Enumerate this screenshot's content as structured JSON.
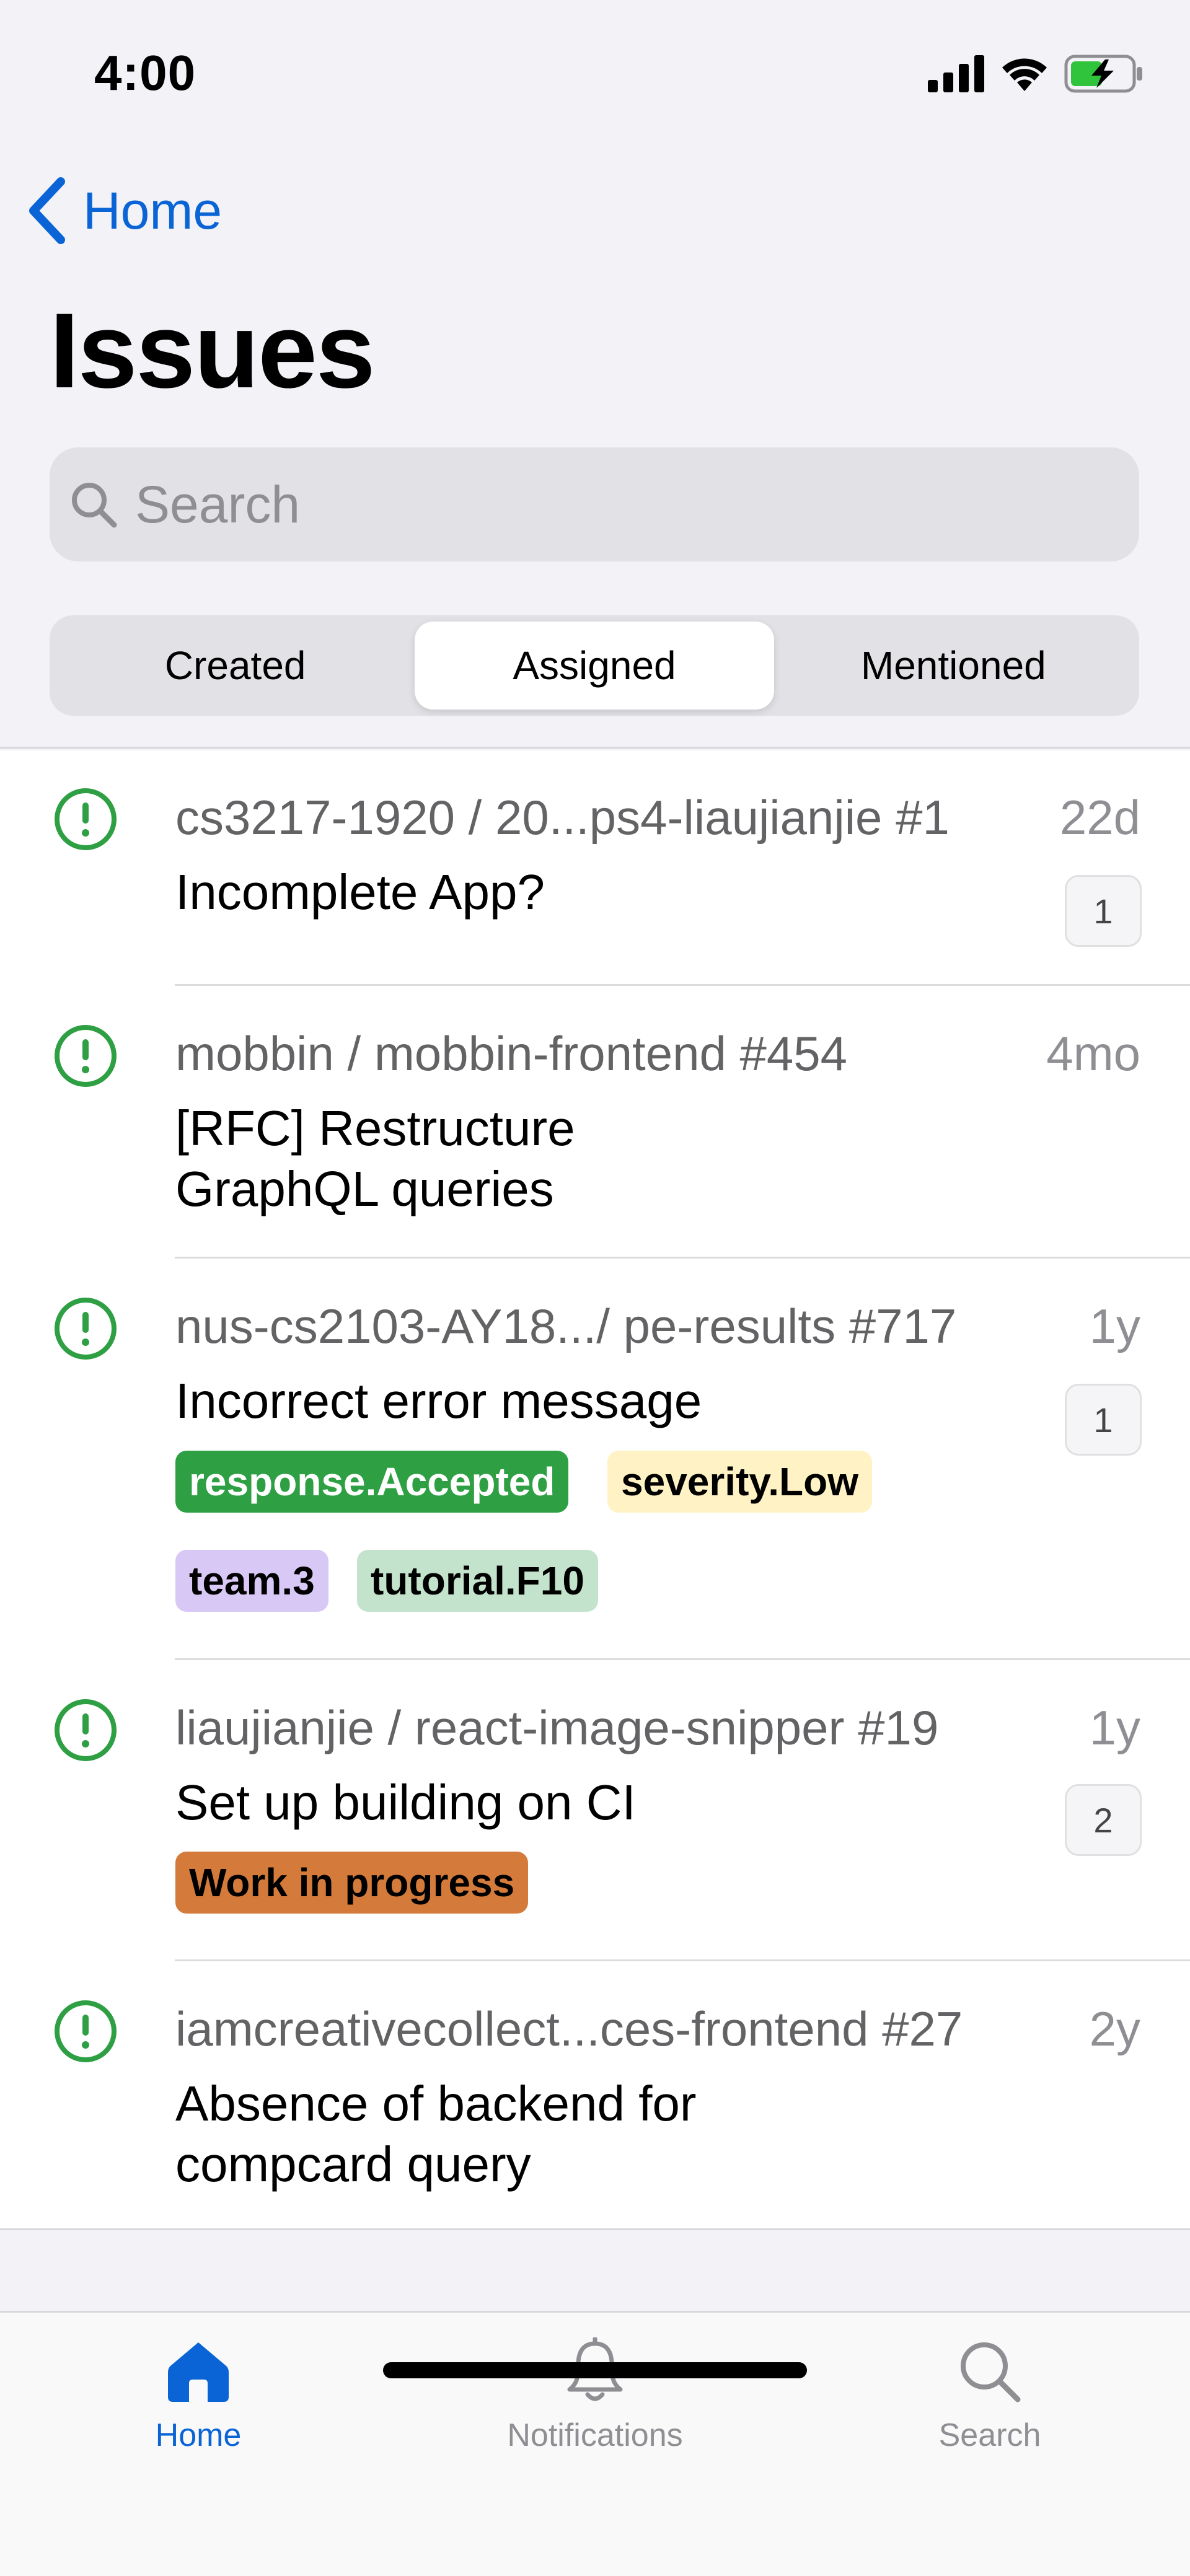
{
  "status_bar": {
    "time": "4:00"
  },
  "nav": {
    "back_label": "Home"
  },
  "page": {
    "title": "Issues"
  },
  "search": {
    "placeholder": "Search",
    "value": ""
  },
  "segments": [
    {
      "label": "Created",
      "active": false
    },
    {
      "label": "Assigned",
      "active": true
    },
    {
      "label": "Mentioned",
      "active": false
    }
  ],
  "issues": [
    {
      "repo": "cs3217-1920 / 20...ps4-liaujianjie #1",
      "title": "Incomplete App?",
      "time": "22d",
      "comments": "1",
      "status_icon": "issue-open-icon",
      "labels": []
    },
    {
      "repo": "mobbin / mobbin-frontend #454",
      "title": "[RFC] Restructure\nGraphQL queries",
      "title_lines": [
        "[RFC] Restructure",
        "GraphQL queries"
      ],
      "time": "4mo",
      "comments": null,
      "status_icon": "issue-open-icon",
      "labels": []
    },
    {
      "repo": "nus-cs2103-AY18.../ pe-results #717",
      "title": "Incorrect error message",
      "time": "1y",
      "comments": "1",
      "status_icon": "issue-open-icon",
      "labels": [
        {
          "name": "response.Accepted",
          "bg": "#2ea043",
          "fg": "#ffffff"
        },
        {
          "name": "severity.Low",
          "bg": "#fff2c4",
          "fg": "#000000"
        },
        {
          "name": "team.3",
          "bg": "#d8c8f5",
          "fg": "#000000"
        },
        {
          "name": "tutorial.F10",
          "bg": "#c3e3cc",
          "fg": "#000000"
        }
      ]
    },
    {
      "repo": "liaujianjie / react-image-snipper #19",
      "title": "Set up building on CI",
      "time": "1y",
      "comments": "2",
      "status_icon": "issue-open-icon",
      "labels": [
        {
          "name": "Work in progress",
          "bg": "#d47a3a",
          "fg": "#000000"
        }
      ]
    },
    {
      "repo": "iamcreativecollect...ces-frontend #27",
      "title_lines": [
        "Absence of backend for",
        "compcard query"
      ],
      "time": "2y",
      "comments": null,
      "status_icon": "issue-open-icon",
      "labels": []
    }
  ],
  "tab_bar": {
    "items": [
      {
        "label": "Home",
        "icon": "home-icon",
        "active": true
      },
      {
        "label": "Notifications",
        "icon": "bell-icon",
        "active": false
      },
      {
        "label": "Search",
        "icon": "search-icon",
        "active": false
      }
    ]
  },
  "colors": {
    "accent": "#0a64d6",
    "open_issue": "#2ea043",
    "secondary_text": "#636366"
  }
}
